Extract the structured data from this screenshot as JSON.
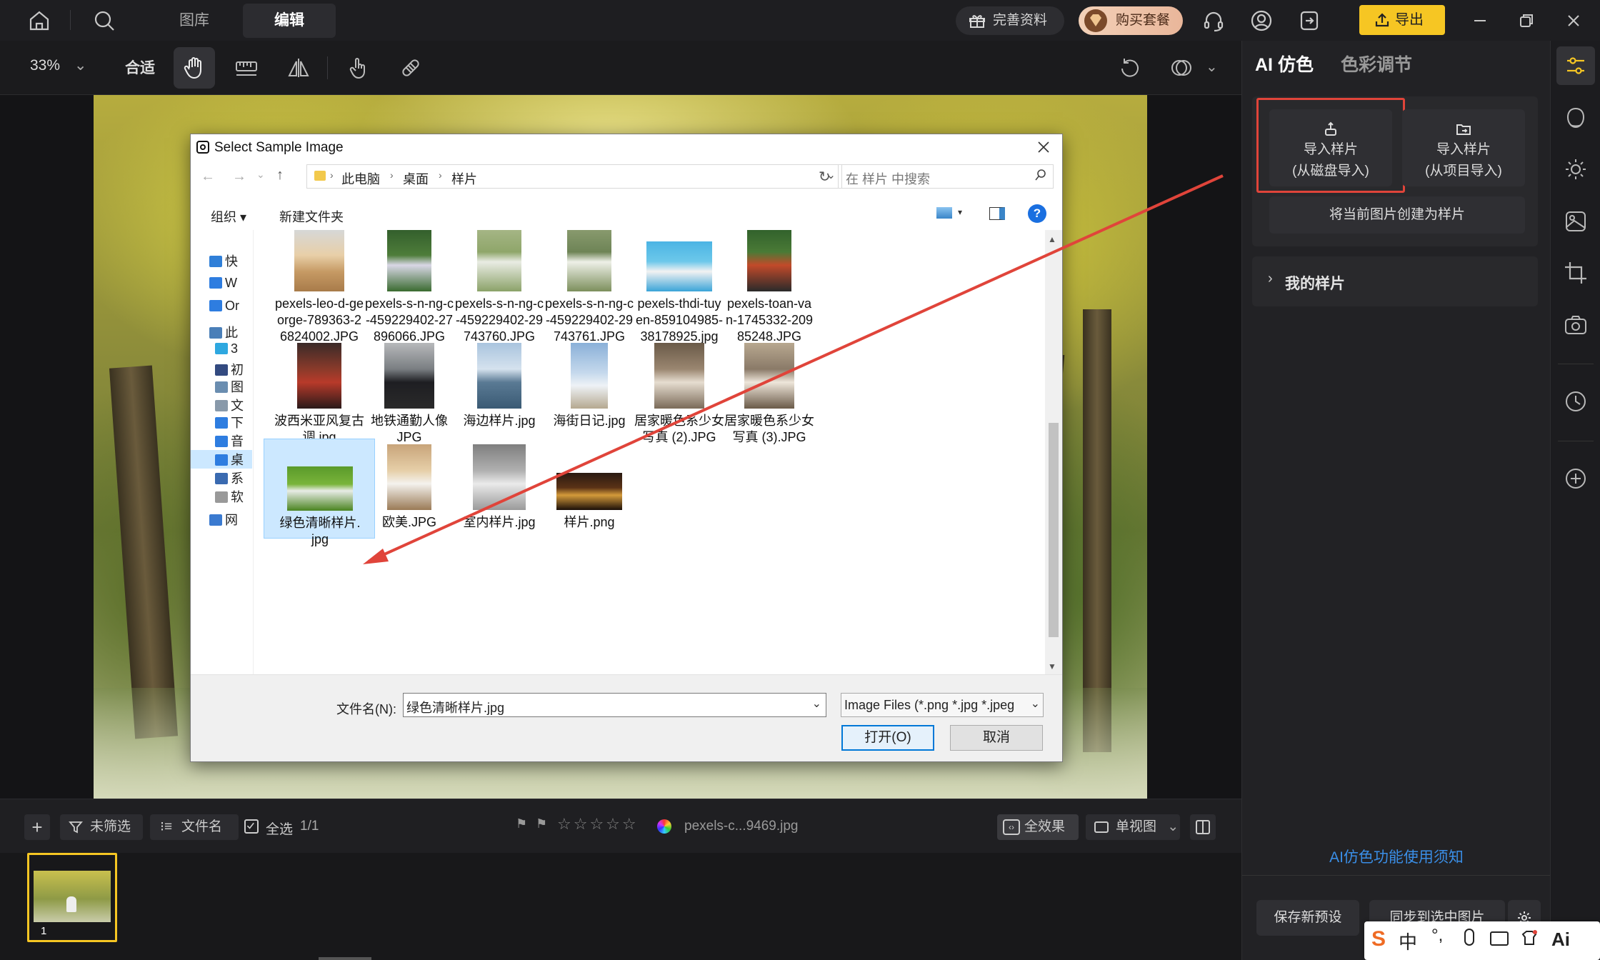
{
  "topbar": {
    "tabs": [
      "图库",
      "编辑"
    ],
    "active_tab": "编辑",
    "profile_label": "完善资料",
    "buy_label": "购买套餐",
    "export_label": "导出"
  },
  "toolbar": {
    "zoom": "33%",
    "fit_label": "合适"
  },
  "dialog": {
    "title": "Select Sample Image",
    "breadcrumb": [
      "此电脑",
      "桌面",
      "样片"
    ],
    "search_placeholder": "在 样片 中搜索",
    "organize_label": "组织 ▾",
    "new_folder_label": "新建文件夹",
    "nav_items": [
      "快",
      "W",
      "Or",
      "此",
      "3",
      "初",
      "图",
      "文",
      "下",
      "音",
      "桌",
      "系",
      "软",
      "网"
    ],
    "files": [
      {
        "name": "pexels-leo-d-george-789363-26824002.JPG",
        "lines": [
          "pexels-leo-d-ge",
          "orge-789363-2",
          "6824002.JPG"
        ],
        "selected": false
      },
      {
        "name": "pexels-s-n-ng-c-459229402-27896066.JPG",
        "lines": [
          "pexels-s-n-ng-c",
          "-459229402-27",
          "896066.JPG"
        ],
        "selected": false
      },
      {
        "name": "pexels-s-n-ng-c-459229402-29743760.JPG",
        "lines": [
          "pexels-s-n-ng-c",
          "-459229402-29",
          "743760.JPG"
        ],
        "selected": false
      },
      {
        "name": "pexels-s-n-ng-c-459229402-29743761.JPG",
        "lines": [
          "pexels-s-n-ng-c",
          "-459229402-29",
          "743761.JPG"
        ],
        "selected": false
      },
      {
        "name": "pexels-thdi-tuyen-859104985-38178925.jpg",
        "lines": [
          "pexels-thdi-tuy",
          "en-859104985-",
          "38178925.jpg"
        ],
        "selected": false
      },
      {
        "name": "pexels-toan-van-1745332-20985248.JPG",
        "lines": [
          "pexels-toan-va",
          "n-1745332-209",
          "85248.JPG"
        ],
        "selected": false
      },
      {
        "name": "波西米亚风复古调.jpg",
        "lines": [
          "波西米亚风复古",
          "调.jpg"
        ],
        "selected": false
      },
      {
        "name": "地铁通勤人像.JPG",
        "lines": [
          "地铁通勤人像",
          "JPG"
        ],
        "selected": false
      },
      {
        "name": "海边样片.jpg",
        "lines": [
          "海边样片.jpg"
        ],
        "selected": false
      },
      {
        "name": "海街日记.jpg",
        "lines": [
          "海街日记.jpg"
        ],
        "selected": false
      },
      {
        "name": "居家暖色系少女写真 (2).JPG",
        "lines": [
          "居家暖色系少女",
          "写真 (2).JPG"
        ],
        "selected": false
      },
      {
        "name": "居家暖色系少女写真 (3).JPG",
        "lines": [
          "居家暖色系少女",
          "写真 (3).JPG"
        ],
        "selected": false
      },
      {
        "name": "绿色清晰样片.jpg",
        "lines": [
          "绿色清晰样片.",
          "jpg"
        ],
        "selected": true
      },
      {
        "name": "欧美.JPG",
        "lines": [
          "欧美.JPG"
        ],
        "selected": false
      },
      {
        "name": "室内样片.jpg",
        "lines": [
          "室内样片.jpg"
        ],
        "selected": false
      },
      {
        "name": "样片.png",
        "lines": [
          "样片.png"
        ],
        "selected": false
      }
    ],
    "filename_label": "文件名(N):",
    "filename_value": "绿色清晰样片.jpg",
    "filetype_value": "Image Files (*.png *.jpg *.jpeg",
    "open_label": "打开(O)",
    "cancel_label": "取消"
  },
  "right_panel": {
    "tabs": [
      "AI 仿色",
      "色彩调节"
    ],
    "import_disk": [
      "导入样片",
      "(从磁盘导入)"
    ],
    "import_project": [
      "导入样片",
      "(从项目导入)"
    ],
    "create_sample": "将当前图片创建为样片",
    "my_samples": "我的样片",
    "help_link": "AI仿色功能使用须知",
    "save_preset": "保存新预设",
    "sync_label": "同步到选中图片"
  },
  "filmbar": {
    "filter_label": "未筛选",
    "sort_label": "文件名",
    "select_all_label": "全选",
    "count": "1/1",
    "current_file": "pexels-c...9469.jpg",
    "all_effects_label": "全效果",
    "single_view_label": "单视图",
    "thumb_index": "1"
  },
  "ime": {
    "mode": "中"
  },
  "colors": {
    "accent_yellow": "#f6c623",
    "highlight_red": "#e0443a",
    "link_blue": "#3a8ee6",
    "selection_blue": "#cce8ff"
  }
}
